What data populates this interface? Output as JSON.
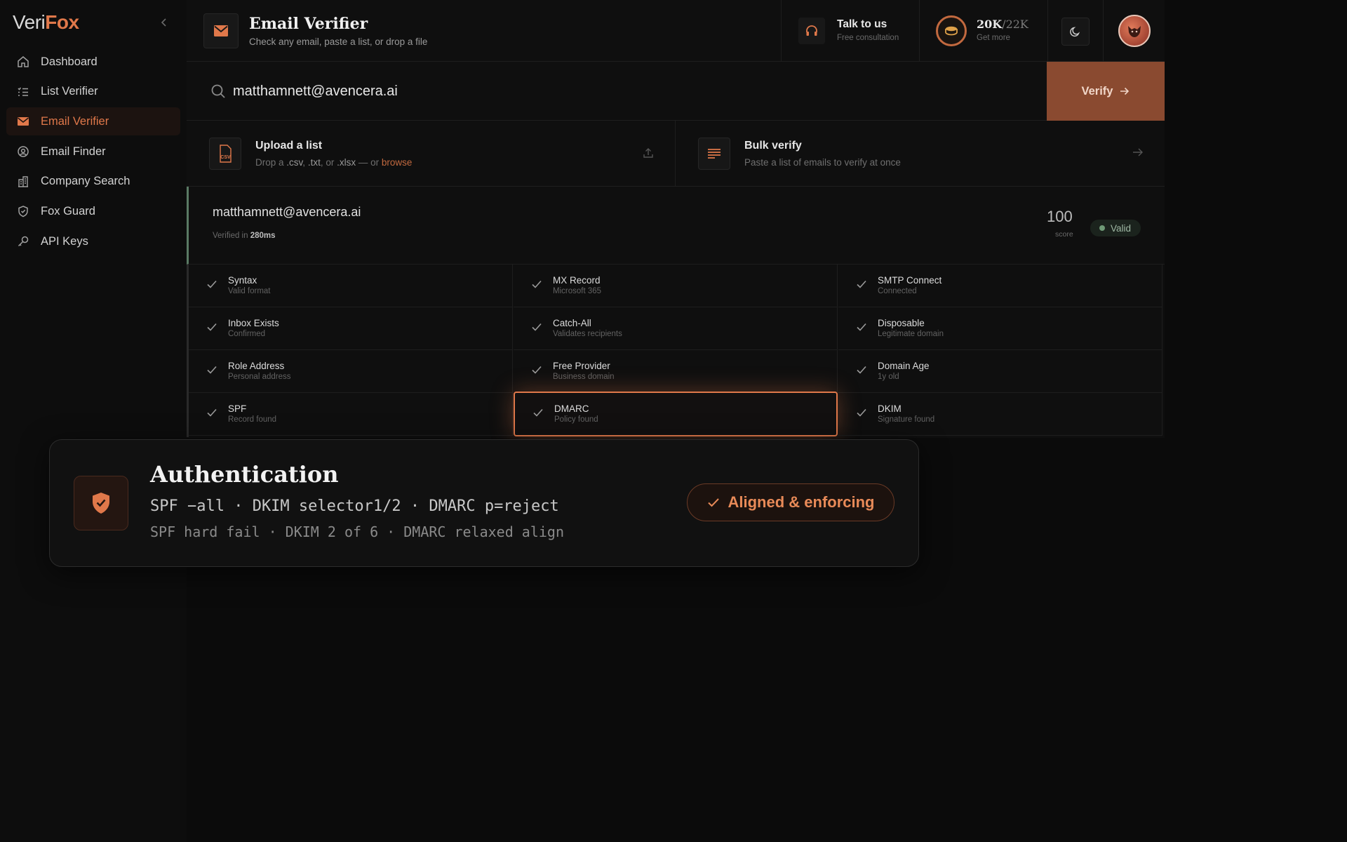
{
  "brand": {
    "part1": "Veri",
    "part2": "Fox"
  },
  "sidebar": {
    "items": [
      {
        "label": "Dashboard",
        "icon": "home-icon"
      },
      {
        "label": "List Verifier",
        "icon": "list-icon"
      },
      {
        "label": "Email Verifier",
        "icon": "mail-icon",
        "active": true
      },
      {
        "label": "Email Finder",
        "icon": "at-icon"
      },
      {
        "label": "Company Search",
        "icon": "building-icon"
      },
      {
        "label": "Fox Guard",
        "icon": "shield-icon"
      },
      {
        "label": "API Keys",
        "icon": "key-icon"
      }
    ]
  },
  "header": {
    "title": "Email Verifier",
    "subtitle": "Check any email, paste a list, or drop a file",
    "talk": {
      "title": "Talk to us",
      "subtitle": "Free consultation"
    },
    "credits": {
      "used": "20K",
      "total": "/22K",
      "subtitle": "Get more"
    }
  },
  "search": {
    "value": "matthamnett@avencera.ai",
    "verify_label": "Verify"
  },
  "upload": {
    "title": "Upload a list",
    "desc_prefix": "Drop a",
    "ext1": ".csv",
    "sep1": ",",
    "ext2": ".txt",
    "sep2": ", or",
    "ext3": ".xlsx",
    "desc_mid": "— or",
    "browse": "browse",
    "icon_text": "CSV"
  },
  "bulk": {
    "title": "Bulk verify",
    "subtitle": "Paste a list of emails to verify at once"
  },
  "result": {
    "email": "matthamnett@avencera.ai",
    "verified_prefix": "Verified in",
    "verified_time": "280ms",
    "score": "100",
    "score_label": "score",
    "status": "Valid"
  },
  "checks": [
    {
      "name": "Syntax",
      "detail": "Valid format"
    },
    {
      "name": "MX Record",
      "detail": "Microsoft 365"
    },
    {
      "name": "SMTP Connect",
      "detail": "Connected"
    },
    {
      "name": "Inbox Exists",
      "detail": "Confirmed"
    },
    {
      "name": "Catch-All",
      "detail": "Validates recipients"
    },
    {
      "name": "Disposable",
      "detail": "Legitimate domain"
    },
    {
      "name": "Role Address",
      "detail": "Personal address"
    },
    {
      "name": "Free Provider",
      "detail": "Business domain"
    },
    {
      "name": "Domain Age",
      "detail": "1y old"
    },
    {
      "name": "SPF",
      "detail": "Record found"
    },
    {
      "name": "DMARC",
      "detail": "Policy found"
    },
    {
      "name": "DKIM",
      "detail": "Signature found"
    }
  ],
  "overlay": {
    "title": "Authentication",
    "line1": "SPF −all · DKIM selector1/2 · DMARC p=reject",
    "line2": "SPF hard fail · DKIM 2 of 6 · DMARC relaxed align",
    "status": "Aligned & enforcing"
  },
  "colors": {
    "accent": "#e0784a",
    "verify_bg": "#8a4a30",
    "valid": "#6f9a76"
  }
}
